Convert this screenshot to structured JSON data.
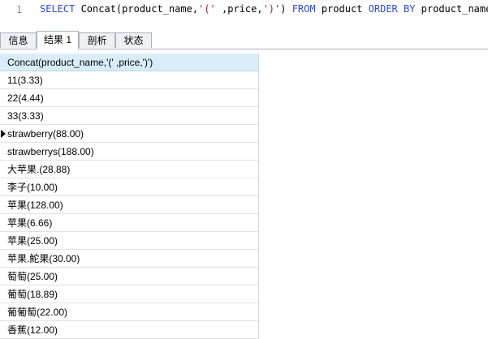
{
  "editor": {
    "line_number": "1",
    "tokens": [
      {
        "text": "SELECT",
        "kind": "kw"
      },
      {
        "text": " Concat(product_name,",
        "kind": "plain"
      },
      {
        "text": "'('",
        "kind": "str"
      },
      {
        "text": " ,price,",
        "kind": "plain"
      },
      {
        "text": "')'",
        "kind": "str"
      },
      {
        "text": ") ",
        "kind": "plain"
      },
      {
        "text": "FROM",
        "kind": "kw"
      },
      {
        "text": " product ",
        "kind": "plain"
      },
      {
        "text": "ORDER BY",
        "kind": "kw"
      },
      {
        "text": " product_name",
        "kind": "plain"
      }
    ]
  },
  "tabs": [
    {
      "label": "信息",
      "active": false
    },
    {
      "label": "结果 1",
      "active": true
    },
    {
      "label": "剖析",
      "active": false
    },
    {
      "label": "状态",
      "active": false
    }
  ],
  "grid": {
    "column_header": "Concat(product_name,'(' ,price,')')",
    "current_row_index": 3,
    "rows": [
      "11(3.33)",
      "22(4.44)",
      "33(3.33)",
      "strawberry(88.00)",
      "strawberrys(188.00)",
      "大苹果.(28.88)",
      "李子(10.00)",
      "苹果(128.00)",
      "苹果(6.66)",
      "苹果(25.00)",
      "苹果.鮀果(30.00)",
      "萄萄(25.00)",
      "葡萄(18.89)",
      "葡葡萄(22.00)",
      "香蕉(12.00)"
    ]
  },
  "colors": {
    "keyword": "#2e4bd1",
    "string": "#b21d1d",
    "header_bg": "#d9edf9"
  }
}
